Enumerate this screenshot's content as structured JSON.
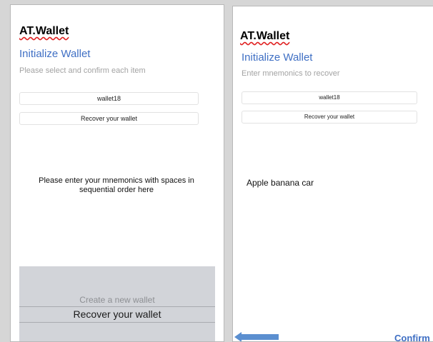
{
  "left_screen": {
    "app_title": "AT.Wallet",
    "section_title": "Initialize Wallet",
    "subtitle": "Please select and confirm each item",
    "wallet_name": "wallet18",
    "mode_value": "Recover your wallet",
    "instructions": "Please enter your mnemonics with spaces in sequential order here",
    "picker": {
      "options": [
        "Create a new wallet",
        "Recover your wallet"
      ],
      "selected": "Recover your wallet"
    }
  },
  "right_screen": {
    "app_title": "AT.Wallet",
    "section_title": "Initialize Wallet",
    "subtitle": "Enter mnemonics to recover",
    "wallet_name": "wallet18",
    "mode_value": "Recover your wallet",
    "mnemonic_text": "Apple banana car",
    "confirm_label": "Confirm",
    "back_icon": "back-arrow-icon"
  },
  "colors": {
    "accent": "#3f6fc4",
    "picker_bg": "#d2d4d9",
    "arrow": "#5b8fd0"
  }
}
